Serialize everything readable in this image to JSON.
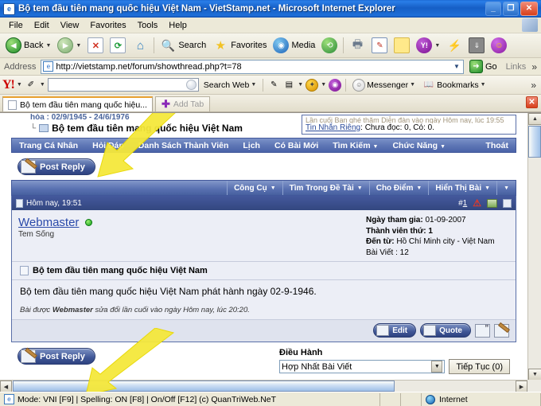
{
  "window": {
    "title": "Bộ tem đầu tiên mang quốc hiệu Việt Nam - VietStamp.net - Microsoft Internet Explorer",
    "app_icon": "ie-icon",
    "minimize": "_",
    "restore": "❐",
    "close": "✕"
  },
  "menu": {
    "items": [
      {
        "label": "File"
      },
      {
        "label": "Edit"
      },
      {
        "label": "View"
      },
      {
        "label": "Favorites"
      },
      {
        "label": "Tools"
      },
      {
        "label": "Help"
      }
    ]
  },
  "toolbar": {
    "back_label": "Back",
    "search_label": "Search",
    "favorites_label": "Favorites",
    "media_label": "Media",
    "icons": [
      "back-arrow-icon",
      "forward-arrow-icon",
      "stop-icon",
      "refresh-icon",
      "home-icon",
      "search-icon",
      "favorites-star-icon",
      "media-icon",
      "history-icon",
      "print-icon",
      "edit-icon",
      "note-icon",
      "yahoo-icon",
      "bolt-icon",
      "download-icon",
      "smiley-icon"
    ]
  },
  "address": {
    "label": "Address",
    "url": "http://vietstamp.net/forum/showthread.php?t=78",
    "go_label": "Go",
    "links_label": "Links"
  },
  "yahoo_toolbar": {
    "logo": "Y!",
    "search_placeholder": "",
    "search_value": "",
    "search_web_label": "Search Web",
    "messenger_label": "Messenger",
    "bookmarks_label": "Bookmarks",
    "overflow": "»"
  },
  "tabs": {
    "active_tab_label": "Bộ tem đầu tiên mang quốc hiệu...",
    "add_tab_label": "Add Tab",
    "close_label": "✕"
  },
  "page": {
    "breadcrumb_cut": "hòa : 02/9/1945 - 24/6/1976",
    "breadcrumb_current": "Bộ tem đầu tiên mang quốc hiệu Việt Nam",
    "userbox_cut": "Lần cuối Bạn ghé thăm Diễn đàn vào ngày Hôm nay, lúc 19:55",
    "pm_link": "Tin Nhắn Riêng",
    "pm_status": "Chưa đọc: 0, Có: 0.",
    "nav": [
      {
        "label": "Trang Cá Nhân",
        "dropdown": false
      },
      {
        "label": "Hỏi Đáp",
        "dropdown": false
      },
      {
        "label": "Danh Sách Thành Viên",
        "dropdown": false
      },
      {
        "label": "Lịch",
        "dropdown": false
      },
      {
        "label": "Có Bài Mới",
        "dropdown": false
      },
      {
        "label": "Tìm Kiếm",
        "dropdown": true
      },
      {
        "label": "Chức Năng",
        "dropdown": true
      },
      {
        "label": "Thoát",
        "dropdown": false
      }
    ],
    "post_reply_label": "Post Reply",
    "thread_tools": [
      {
        "label": "Công Cụ"
      },
      {
        "label": "Tìm Trong Đề Tài"
      },
      {
        "label": "Cho Điểm"
      },
      {
        "label": "Hiển Thị Bài"
      }
    ],
    "post": {
      "date": "Hôm nay, 19:51",
      "number": "#1",
      "username": "Webmaster",
      "rank": "Tem Sống",
      "join_label": "Ngày tham gia",
      "join_value": "01-09-2007",
      "member_label": "Thành viên thứ",
      "member_value": "1",
      "from_label": "Đến từ",
      "from_value": "Hồ Chí Minh city - Việt Nam",
      "posts_label": "Bài Viết",
      "posts_value": "12",
      "title": "Bộ tem đầu tiên mang quốc hiệu Việt Nam",
      "content": "Bộ tem đầu tiên mang quốc hiệu Việt Nam phát hành ngày 02-9-1946.",
      "edit_note_pre": "Bài được",
      "edit_note_user": "Webmaster",
      "edit_note_post": "sửa đổi lần cuối vào ngày Hôm nay, lúc 20:20.",
      "edit_label": "Edit",
      "quote_label": "Quote"
    },
    "moderation": {
      "label": "Điều Hành",
      "selected": "Hợp Nhất Bài Viết",
      "go_label": "Tiếp Tục (0)"
    }
  },
  "statusbar": {
    "message": "Mode: VNI [F9] | Spelling: ON [F8] | On/Off [F12] (c) QuanTriWeb.NeT",
    "zone": "Internet"
  },
  "colors": {
    "title_blue": "#1d6ad4",
    "nav_blue": "#5c74b4",
    "post_header": "#3a4f8d",
    "link_blue": "#2a4aaa",
    "online_green": "#0f9a18",
    "arrow_yellow": "#f5e83c"
  }
}
